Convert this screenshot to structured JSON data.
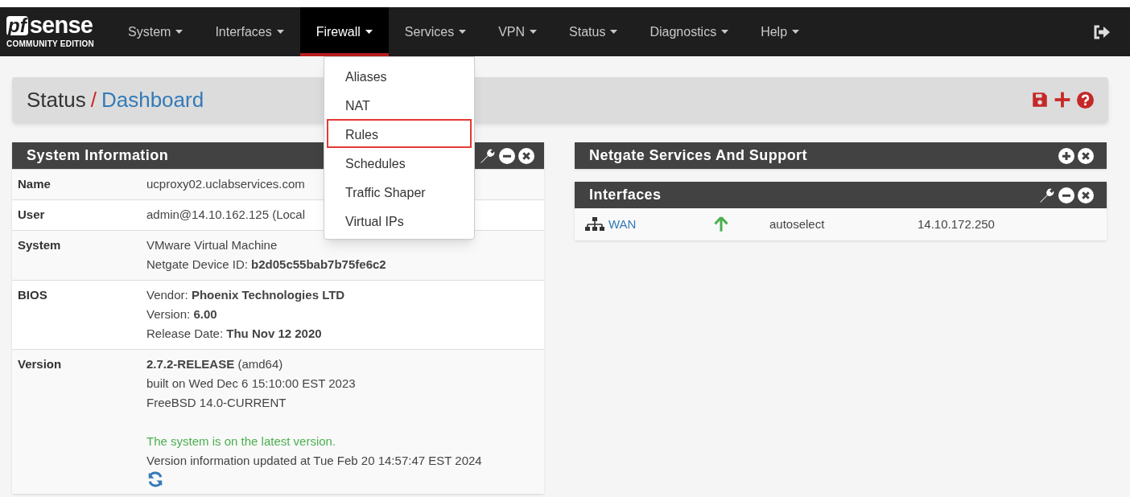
{
  "logo": {
    "text": "sense",
    "mark": "pf",
    "edition": "COMMUNITY EDITION"
  },
  "nav": [
    {
      "label": "System",
      "selected": false
    },
    {
      "label": "Interfaces",
      "selected": false
    },
    {
      "label": "Firewall",
      "selected": true
    },
    {
      "label": "Services",
      "selected": false
    },
    {
      "label": "VPN",
      "selected": false
    },
    {
      "label": "Status",
      "selected": false
    },
    {
      "label": "Diagnostics",
      "selected": false
    },
    {
      "label": "Help",
      "selected": false
    }
  ],
  "dropdown": [
    {
      "label": "Aliases",
      "highlighted": false
    },
    {
      "label": "NAT",
      "highlighted": false
    },
    {
      "label": "Rules",
      "highlighted": true
    },
    {
      "label": "Schedules",
      "highlighted": false
    },
    {
      "label": "Traffic Shaper",
      "highlighted": false
    },
    {
      "label": "Virtual IPs",
      "highlighted": false
    }
  ],
  "breadcrumb": {
    "parent": "Status",
    "separator": "/",
    "current": "Dashboard"
  },
  "system_information": {
    "title": "System Information",
    "rows": [
      {
        "key": "Name",
        "lines": [
          {
            "text": "ucproxy02.uclabservices.com",
            "kind": "plain"
          }
        ]
      },
      {
        "key": "User",
        "lines": [
          {
            "text": "admin@14.10.162.125 (Local",
            "kind": "plain"
          }
        ]
      },
      {
        "key": "System",
        "lines": [
          {
            "text": "VMware Virtual Machine",
            "kind": "plain"
          },
          {
            "text": "Netgate Device ID: **b2d05c55bab7b75fe6c2**",
            "kind": "plain"
          }
        ]
      },
      {
        "key": "BIOS",
        "lines": [
          {
            "text": "Vendor: **Phoenix Technologies LTD**",
            "kind": "plain"
          },
          {
            "text": "Version: **6.00**",
            "kind": "plain"
          },
          {
            "text": "Release Date: **Thu Nov 12 2020**",
            "kind": "plain"
          }
        ]
      },
      {
        "key": "Version",
        "lines": [
          {
            "text": "**2.7.2-RELEASE** (amd64)",
            "kind": "plain"
          },
          {
            "text": "built on Wed Dec 6 15:10:00 EST 2023",
            "kind": "plain"
          },
          {
            "text": "FreeBSD 14.0-CURRENT",
            "kind": "plain"
          },
          {
            "text": "The system is on the latest version.",
            "kind": "success"
          },
          {
            "text": "Version information updated at Tue Feb 20 14:57:47 EST 2024",
            "kind": "plain"
          }
        ]
      }
    ]
  },
  "netgate_services": {
    "title": "Netgate Services And Support"
  },
  "interfaces": {
    "title": "Interfaces",
    "rows": [
      {
        "name": "WAN",
        "status_up": true,
        "media": "autoselect",
        "address": "14.10.172.250"
      }
    ]
  }
}
